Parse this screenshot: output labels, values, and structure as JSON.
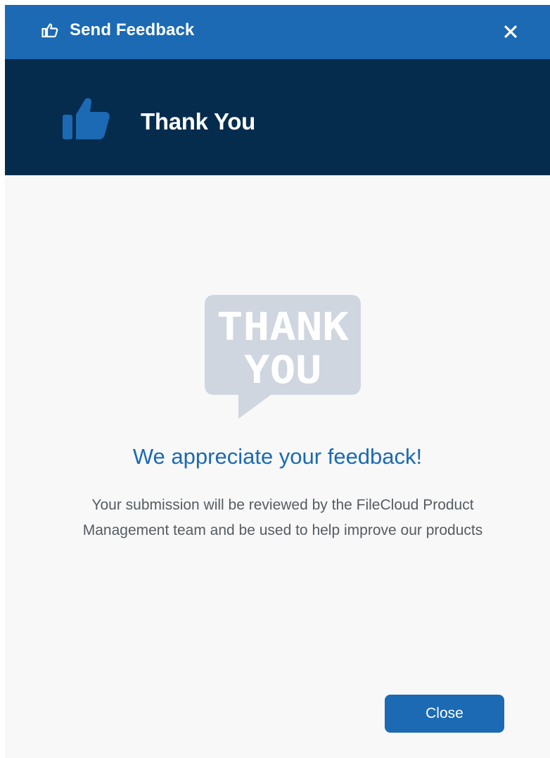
{
  "dialog": {
    "title": "Send Feedback",
    "title_icon": "thumbs-up-outline-icon",
    "close_icon": "close-icon"
  },
  "hero": {
    "icon": "thumbs-up-icon",
    "title": "Thank You"
  },
  "illustration": {
    "icon": "thank-you-speech-bubble",
    "line1": "THANK",
    "line2": "YOU"
  },
  "message": {
    "heading": "We appreciate your feedback!",
    "body": "Your submission will be reviewed by the FileCloud Product Management team and be used to help improve our products"
  },
  "actions": {
    "close_label": "Close"
  },
  "colors": {
    "titlebar": "#1b6ab3",
    "hero_background": "#062c4d",
    "accent": "#1b6ab3",
    "illustration": "#cfd6e0",
    "body_background": "#f8f8f8"
  }
}
